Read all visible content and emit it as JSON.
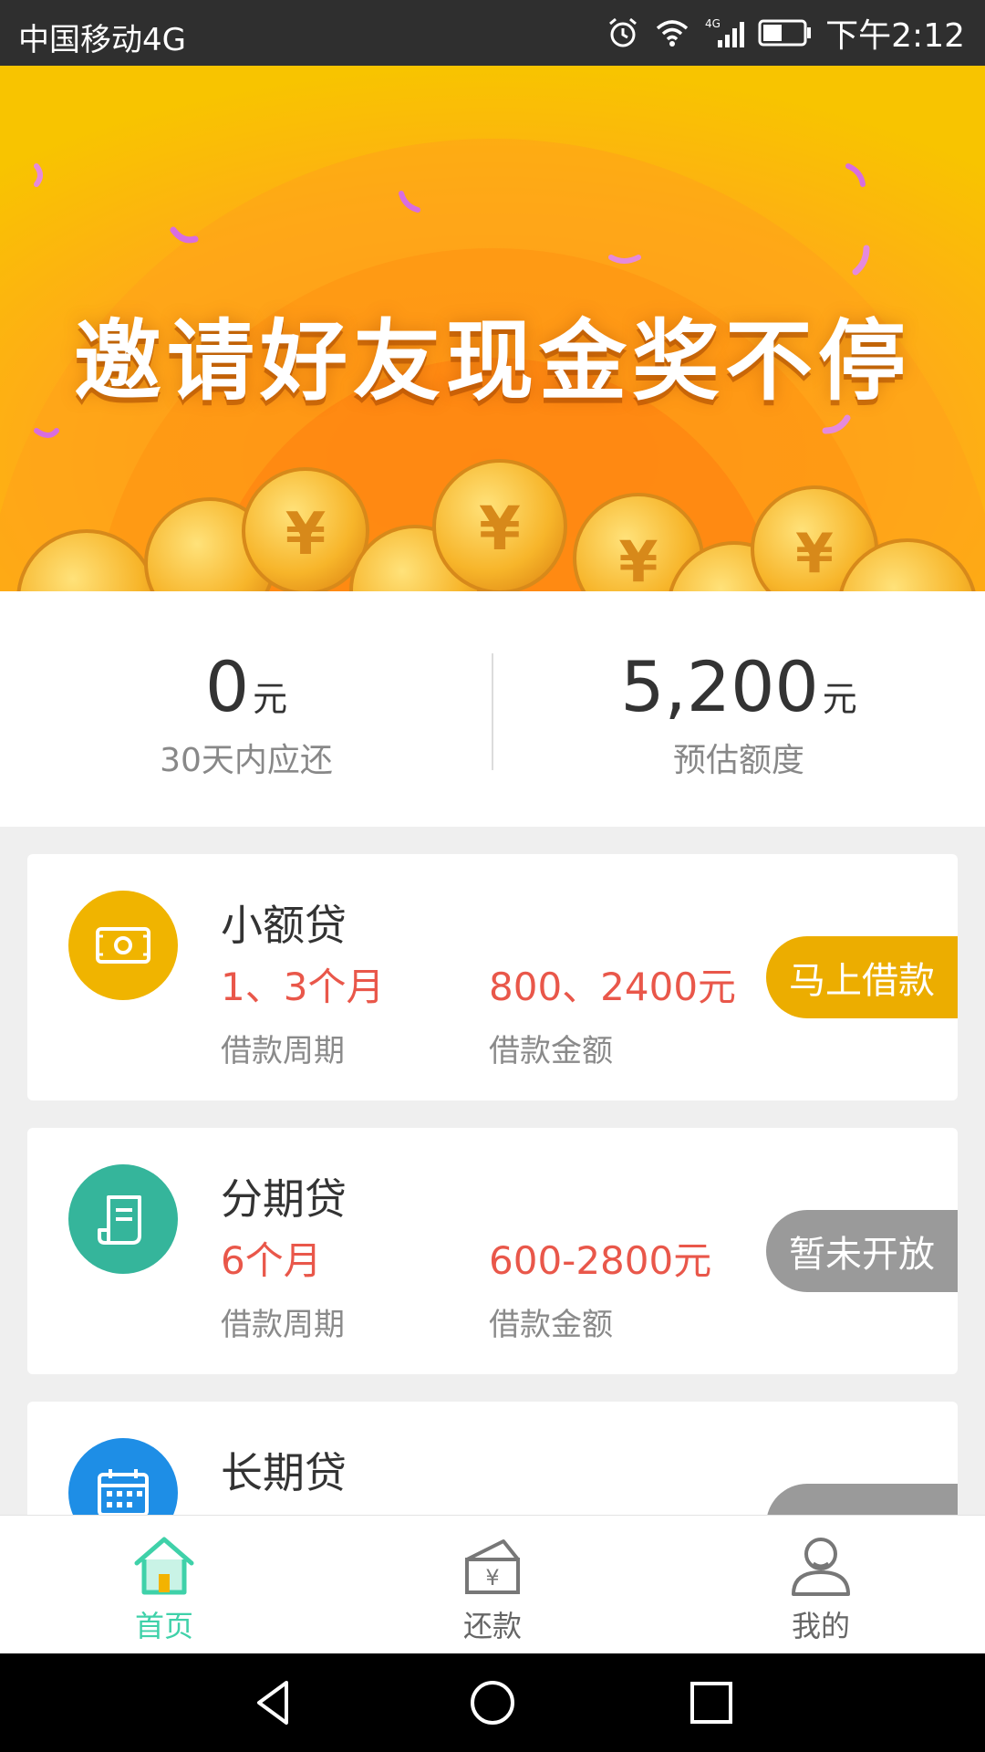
{
  "status_bar": {
    "carrier": "中国移动4G",
    "time": "下午2:12",
    "icons": [
      "alarm-icon",
      "wifi-icon",
      "cellular-signal-icon",
      "battery-icon"
    ],
    "network_badge": "4G"
  },
  "banner": {
    "headline": "邀请好友现金奖不停",
    "slide_count": 2,
    "active_slide": 2
  },
  "summary": {
    "due": {
      "amount": "0",
      "unit": "元",
      "label": "30天内应还"
    },
    "limit": {
      "amount": "5,200",
      "unit": "元",
      "label": "预估额度"
    }
  },
  "loans": [
    {
      "title": "小额贷",
      "period": "1、3个月",
      "amount": "800、2400元",
      "period_label": "借款周期",
      "amount_label": "借款金额",
      "action": "马上借款",
      "icon": "cash-icon",
      "icon_color": "#f0b400",
      "action_color": "#ecad00"
    },
    {
      "title": "分期贷",
      "period": "6个月",
      "amount": "600-2800元",
      "period_label": "借款周期",
      "amount_label": "借款金额",
      "action": "暂未开放",
      "icon": "scroll-document-icon",
      "icon_color": "#35b59b",
      "action_color": "#9a9a9a"
    },
    {
      "title": "长期贷",
      "period": "",
      "amount": "",
      "period_label": "",
      "amount_label": "",
      "action": "",
      "icon": "calendar-icon",
      "icon_color": "#1e8ee6",
      "action_color": "#9a9a9a"
    }
  ],
  "bottom_nav": {
    "items": [
      {
        "label": "首页",
        "icon": "home-icon",
        "active": true
      },
      {
        "label": "还款",
        "icon": "repayment-envelope-icon",
        "active": false
      },
      {
        "label": "我的",
        "icon": "user-profile-icon",
        "active": false
      }
    ],
    "active_color": "#3fd1a9",
    "inactive_color": "#666666"
  },
  "system_nav": {
    "icons": [
      "back-triangle-icon",
      "home-circle-icon",
      "recents-square-icon"
    ]
  }
}
